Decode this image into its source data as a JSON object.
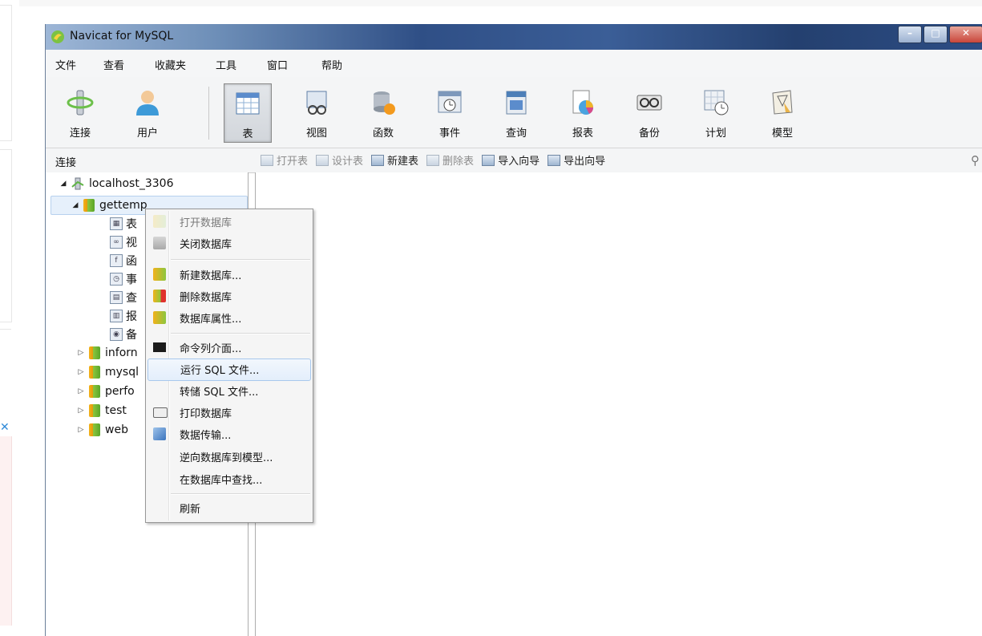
{
  "window": {
    "title": "Navicat for MySQL"
  },
  "menubar": [
    "文件",
    "查看",
    "收藏夹",
    "工具",
    "窗口",
    "帮助"
  ],
  "toolbar": [
    {
      "label": "连接",
      "icon": "connection-icon"
    },
    {
      "label": "用户",
      "icon": "user-icon"
    },
    {
      "label": "表",
      "icon": "table-icon",
      "active": true
    },
    {
      "label": "视图",
      "icon": "view-icon"
    },
    {
      "label": "函数",
      "icon": "function-icon"
    },
    {
      "label": "事件",
      "icon": "event-icon"
    },
    {
      "label": "查询",
      "icon": "query-icon"
    },
    {
      "label": "报表",
      "icon": "report-icon"
    },
    {
      "label": "备份",
      "icon": "backup-icon"
    },
    {
      "label": "计划",
      "icon": "schedule-icon"
    },
    {
      "label": "模型",
      "icon": "model-icon"
    }
  ],
  "subbar": {
    "connection_label": "连接",
    "actions": [
      {
        "label": "打开表",
        "enabled": false
      },
      {
        "label": "设计表",
        "enabled": false
      },
      {
        "label": "新建表",
        "enabled": true
      },
      {
        "label": "删除表",
        "enabled": false
      },
      {
        "label": "导入向导",
        "enabled": true
      },
      {
        "label": "导出向导",
        "enabled": true
      }
    ]
  },
  "tree": {
    "host": "localhost_3306",
    "selected_db": "gettemp",
    "children": [
      "表",
      "视",
      "函",
      "事",
      "查",
      "报",
      "备"
    ],
    "databases": [
      "inforn",
      "mysql",
      "perfo",
      "test",
      "web"
    ]
  },
  "context_menu": {
    "items": [
      {
        "label": "打开数据库",
        "enabled": false
      },
      {
        "label": "关闭数据库",
        "enabled": true
      },
      {
        "label": "新建数据库...",
        "enabled": true
      },
      {
        "label": "删除数据库",
        "enabled": true
      },
      {
        "label": "数据库属性...",
        "enabled": true
      },
      {
        "label": "命令列介面...",
        "enabled": true
      },
      {
        "label": "运行 SQL 文件...",
        "enabled": true,
        "hover": true
      },
      {
        "label": "转储 SQL 文件...",
        "enabled": true
      },
      {
        "label": "打印数据库",
        "enabled": true
      },
      {
        "label": "数据传输...",
        "enabled": true
      },
      {
        "label": "逆向数据库到模型...",
        "enabled": true
      },
      {
        "label": "在数据库中查找...",
        "enabled": true
      },
      {
        "label": "刷新",
        "enabled": true
      }
    ]
  },
  "colors": {
    "title_bar": "#2f4f86",
    "selection": "#e6f0fb",
    "hover_border": "#a8c8ec"
  }
}
